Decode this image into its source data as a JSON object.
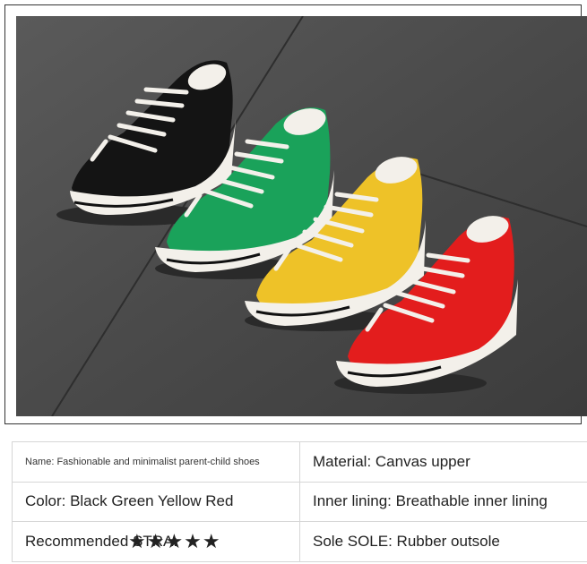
{
  "image": {
    "alt": "Four pairs of low-top canvas sneakers in black, green, yellow and red on a grey tile floor"
  },
  "colors": {
    "floor": "#4a4a4a",
    "shoe_black": "#141414",
    "shoe_green": "#1aa25a",
    "shoe_yellow": "#eec228",
    "shoe_red": "#e31d1d",
    "sole": "#f3f0ea"
  },
  "specs": {
    "name": "Name: Fashionable and minimalist parent-child shoes",
    "material": "Material: Canvas upper",
    "color": "Color: Black Green Yellow Red",
    "inner_lining": "Inner lining: Breathable inner lining",
    "recommended": "Recommended STRA:",
    "rating": 5,
    "stars": "★★★★★",
    "sole": "Sole SOLE: Rubber outsole"
  }
}
